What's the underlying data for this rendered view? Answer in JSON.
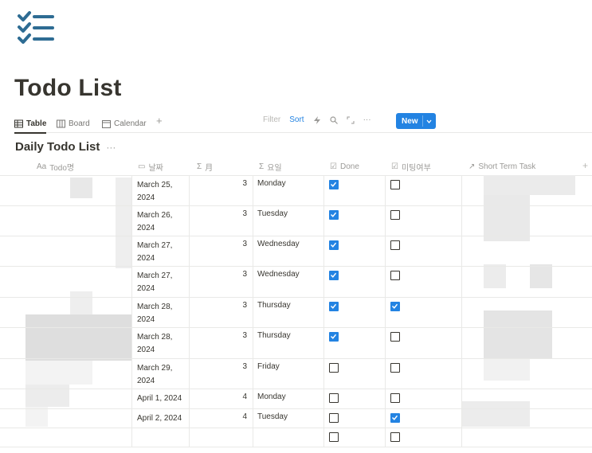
{
  "page": {
    "title": "Todo List",
    "icon": "checklist-icon"
  },
  "views": {
    "tabs": [
      {
        "label": "Table",
        "icon": "table-icon",
        "active": true
      },
      {
        "label": "Board",
        "icon": "board-icon",
        "active": false
      },
      {
        "label": "Calendar",
        "icon": "calendar-icon",
        "active": false
      }
    ],
    "add_view": "+",
    "filter_label": "Filter",
    "sort_label": "Sort",
    "more_label": "···",
    "new_label": "New"
  },
  "database": {
    "title": "Daily Todo List",
    "menu": "···"
  },
  "columns": [
    {
      "icon": "Aa",
      "label": "Todo명"
    },
    {
      "icon": "▭",
      "label": "날짜"
    },
    {
      "icon": "Σ",
      "label": "月"
    },
    {
      "icon": "Σ",
      "label": "요일"
    },
    {
      "icon": "☑",
      "label": "Done"
    },
    {
      "icon": "☑",
      "label": "미팅여부"
    },
    {
      "icon": "↗",
      "label": "Short Term Task"
    }
  ],
  "add_column": "+",
  "rows": [
    {
      "date": "March 25, 2024",
      "month": "3",
      "day": "Monday",
      "done": true,
      "meeting": false
    },
    {
      "date": "March 26, 2024",
      "month": "3",
      "day": "Tuesday",
      "done": true,
      "meeting": false
    },
    {
      "date": "March 27, 2024",
      "month": "3",
      "day": "Wednesday",
      "done": true,
      "meeting": false
    },
    {
      "date": "March 27, 2024",
      "month": "3",
      "day": "Wednesday",
      "done": true,
      "meeting": false
    },
    {
      "date": "March 28, 2024",
      "month": "3",
      "day": "Thursday",
      "done": true,
      "meeting": true
    },
    {
      "date": "March 28, 2024",
      "month": "3",
      "day": "Thursday",
      "done": true,
      "meeting": false
    },
    {
      "date": "March 29, 2024",
      "month": "3",
      "day": "Friday",
      "done": false,
      "meeting": false
    },
    {
      "date": "April 1, 2024",
      "month": "4",
      "day": "Monday",
      "done": false,
      "meeting": false
    },
    {
      "date": "April 2, 2024",
      "month": "4",
      "day": "Tuesday",
      "done": false,
      "meeting": true
    },
    {
      "date": "",
      "month": "",
      "day": "",
      "done": false,
      "meeting": false
    }
  ],
  "colors": {
    "accent": "#2383e2",
    "text": "#37352f",
    "muted": "#9b9a97",
    "logo": "#2e6c93"
  }
}
